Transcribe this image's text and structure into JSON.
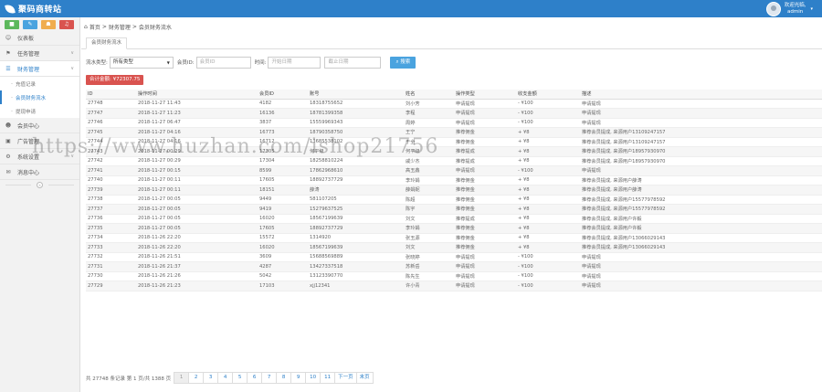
{
  "header": {
    "brand": "聚码商转站",
    "user_line1": "欢迎光临,",
    "user_line2": "admin",
    "caret": "▾"
  },
  "sidebar": {
    "shortcuts": [
      {
        "icon": "■",
        "color": "#5cb85c"
      },
      {
        "icon": "✎",
        "color": "#4aa3df"
      },
      {
        "icon": "☗",
        "color": "#f0ad4e"
      },
      {
        "icon": "♫",
        "color": "#d9534f"
      }
    ],
    "items": [
      {
        "icon": "☺",
        "label": "仪表板"
      },
      {
        "icon": "⚑",
        "label": "任务管理"
      },
      {
        "icon": "☰",
        "label": "财务管理"
      },
      {
        "icon": "☻",
        "label": "会员中心"
      },
      {
        "icon": "▣",
        "label": "广告管理"
      },
      {
        "icon": "⚙",
        "label": "系统设置"
      },
      {
        "icon": "✉",
        "label": "消息中心"
      }
    ],
    "subitems": [
      "充值记录",
      "会员财务流水",
      "提现申请"
    ],
    "collapse": "«"
  },
  "main": {
    "breadcrumb": [
      "首页",
      "财务管理",
      "会员财务流水"
    ],
    "tab": "会员财务流水",
    "filters": {
      "type_label": "流水类型:",
      "type_value": "所有类型",
      "member_label": "会员ID:",
      "member_placeholder": "会员ID",
      "time_label": "时间:",
      "start_placeholder": "开始日期",
      "end_placeholder": "截止日期",
      "search_label": "搜索"
    },
    "total": "合计金额: ¥72307.75"
  },
  "table": {
    "headers": [
      "ID",
      "操作时间",
      "会员ID",
      "账号",
      "姓名",
      "操作类型",
      "收支金额",
      "描述"
    ],
    "rows": [
      [
        "27748",
        "2018-11-27 11:43",
        "4182",
        "18318755652",
        "刘小芳",
        "申请提现",
        "- ¥100",
        "申请提现"
      ],
      [
        "27747",
        "2018-11-27 11:23",
        "16136",
        "18781399358",
        "李程",
        "申请提现",
        "- ¥100",
        "申请提现"
      ],
      [
        "27746",
        "2018-11-27 06:47",
        "3837",
        "15559969343",
        "周婷",
        "申请提现",
        "- ¥100",
        "申请提现"
      ],
      [
        "27745",
        "2018-11-27 04:16",
        "16773",
        "18790358750",
        "王宁",
        "推荐佣金",
        "+ ¥8",
        "推荐会员提成, 来源用户13109247157"
      ],
      [
        "27744",
        "2018-11-27 04:16",
        "16712",
        "13685538102",
        "于全",
        "推荐佣金",
        "+ ¥8",
        "推荐会员提成, 来源用户13109247157"
      ],
      [
        "27743",
        "2018-11-27 00:29",
        "17305",
        "何平级",
        "何平级",
        "推荐提成",
        "+ ¥8",
        "推荐会员提成, 来源用户18957930970"
      ],
      [
        "27742",
        "2018-11-27 00:29",
        "17304",
        "18258810224",
        "戚少杰",
        "推荐提成",
        "+ ¥8",
        "推荐会员提成, 来源用户18957930970"
      ],
      [
        "27741",
        "2018-11-27 00:15",
        "8599",
        "17862968610",
        "高玉鑫",
        "申请提现",
        "- ¥100",
        "申请提现"
      ],
      [
        "27740",
        "2018-11-27 00:11",
        "17605",
        "18892737729",
        "李玲娟",
        "推荐佣金",
        "+ ¥8",
        "推荐会员提成, 来源用户薛涛"
      ],
      [
        "27739",
        "2018-11-27 00:11",
        "18151",
        "薛涛",
        "薛娟妮",
        "推荐佣金",
        "+ ¥8",
        "推荐会员提成, 来源用户薛涛"
      ],
      [
        "27738",
        "2018-11-27 00:05",
        "9449",
        "581107205",
        "陈超",
        "推荐佣金",
        "+ ¥8",
        "推荐会员提成, 来源用户15577978592"
      ],
      [
        "27737",
        "2018-11-27 00:05",
        "9419",
        "15279637525",
        "陈宇",
        "推荐佣金",
        "+ ¥8",
        "推荐会员提成, 来源用户15577978592"
      ],
      [
        "27736",
        "2018-11-27 00:05",
        "16020",
        "18567199639",
        "刘文",
        "推荐提成",
        "+ ¥8",
        "推荐会员提成, 来源用户许毅"
      ],
      [
        "27735",
        "2018-11-27 00:05",
        "17605",
        "18892737729",
        "李玲娟",
        "推荐佣金",
        "+ ¥8",
        "推荐会员提成, 来源用户许毅"
      ],
      [
        "27734",
        "2018-11-26 22:20",
        "15572",
        "1314920",
        "张玉源",
        "推荐佣金",
        "+ ¥8",
        "推荐会员提成, 来源用户13066029143"
      ],
      [
        "27733",
        "2018-11-26 22:20",
        "16020",
        "18567199639",
        "刘文",
        "推荐佣金",
        "+ ¥8",
        "推荐会员提成, 来源用户13066029143"
      ],
      [
        "27732",
        "2018-11-26 21:51",
        "3609",
        "15688569889",
        "张晓婷",
        "申请提现",
        "- ¥100",
        "申请提现"
      ],
      [
        "27731",
        "2018-11-26 21:37",
        "4287",
        "13427337518",
        "苏新岳",
        "申请提现",
        "- ¥100",
        "申请提现"
      ],
      [
        "27730",
        "2018-11-26 21:26",
        "5042",
        "13123390770",
        "陈先生",
        "申请提现",
        "- ¥100",
        "申请提现"
      ],
      [
        "27729",
        "2018-11-26 21:23",
        "17103",
        "xjj12341",
        "许小青",
        "申请提现",
        "- ¥100",
        "申请提现"
      ]
    ]
  },
  "pager": {
    "info": "共 27748 条记录 第 1 页/共 1388 页",
    "pages": [
      "1",
      "2",
      "3",
      "4",
      "5",
      "6",
      "7",
      "8",
      "9",
      "10",
      "11",
      "下一页",
      "末页"
    ]
  },
  "watermark": "https://www.huzhan.com/ishop21756"
}
